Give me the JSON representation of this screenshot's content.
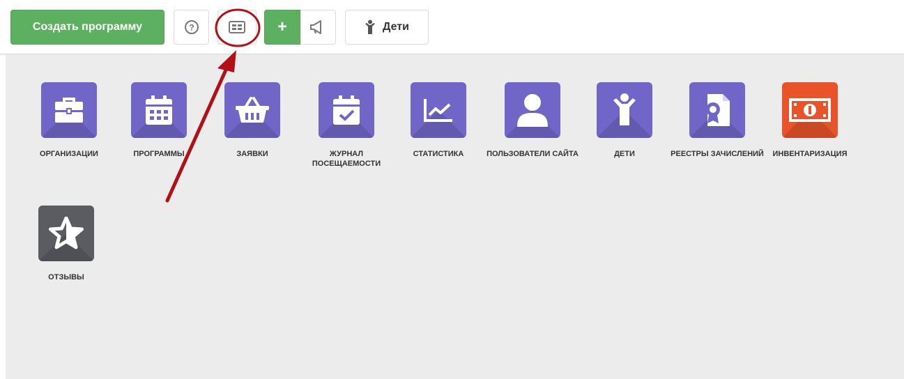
{
  "toolbar": {
    "create_label": "Создать программу",
    "help_glyph": "?",
    "plus_glyph": "+",
    "kids_label": "Дети"
  },
  "colors": {
    "green": "#5cb05f",
    "tile_purple": "#7166c8",
    "tile_orange": "#e8532a",
    "tile_grey": "#5b5b62",
    "annotation_red": "#b01016"
  },
  "tiles": [
    {
      "label": "ОРГАНИЗАЦИИ",
      "icon": "briefcase-icon"
    },
    {
      "label": "ПРОГРАММЫ",
      "icon": "calendar-icon"
    },
    {
      "label": "ЗАЯВКИ",
      "icon": "basket-icon"
    },
    {
      "label": "ЖУРНАЛ ПОСЕЩАЕМОСТИ",
      "icon": "calendar-check-icon"
    },
    {
      "label": "СТАТИСТИКА",
      "icon": "chart-icon"
    },
    {
      "label": "ПОЛЬЗОВАТЕЛИ САЙТА",
      "icon": "user-icon"
    },
    {
      "label": "ДЕТИ",
      "icon": "child-icon"
    },
    {
      "label": "РЕЕСТРЫ ЗАЧИСЛЕНИЙ",
      "icon": "certificate-icon"
    },
    {
      "label": "ИНВЕНТАРИЗАЦИЯ",
      "icon": "money-icon"
    },
    {
      "label": "ОТЗЫВЫ",
      "icon": "star-icon"
    }
  ]
}
